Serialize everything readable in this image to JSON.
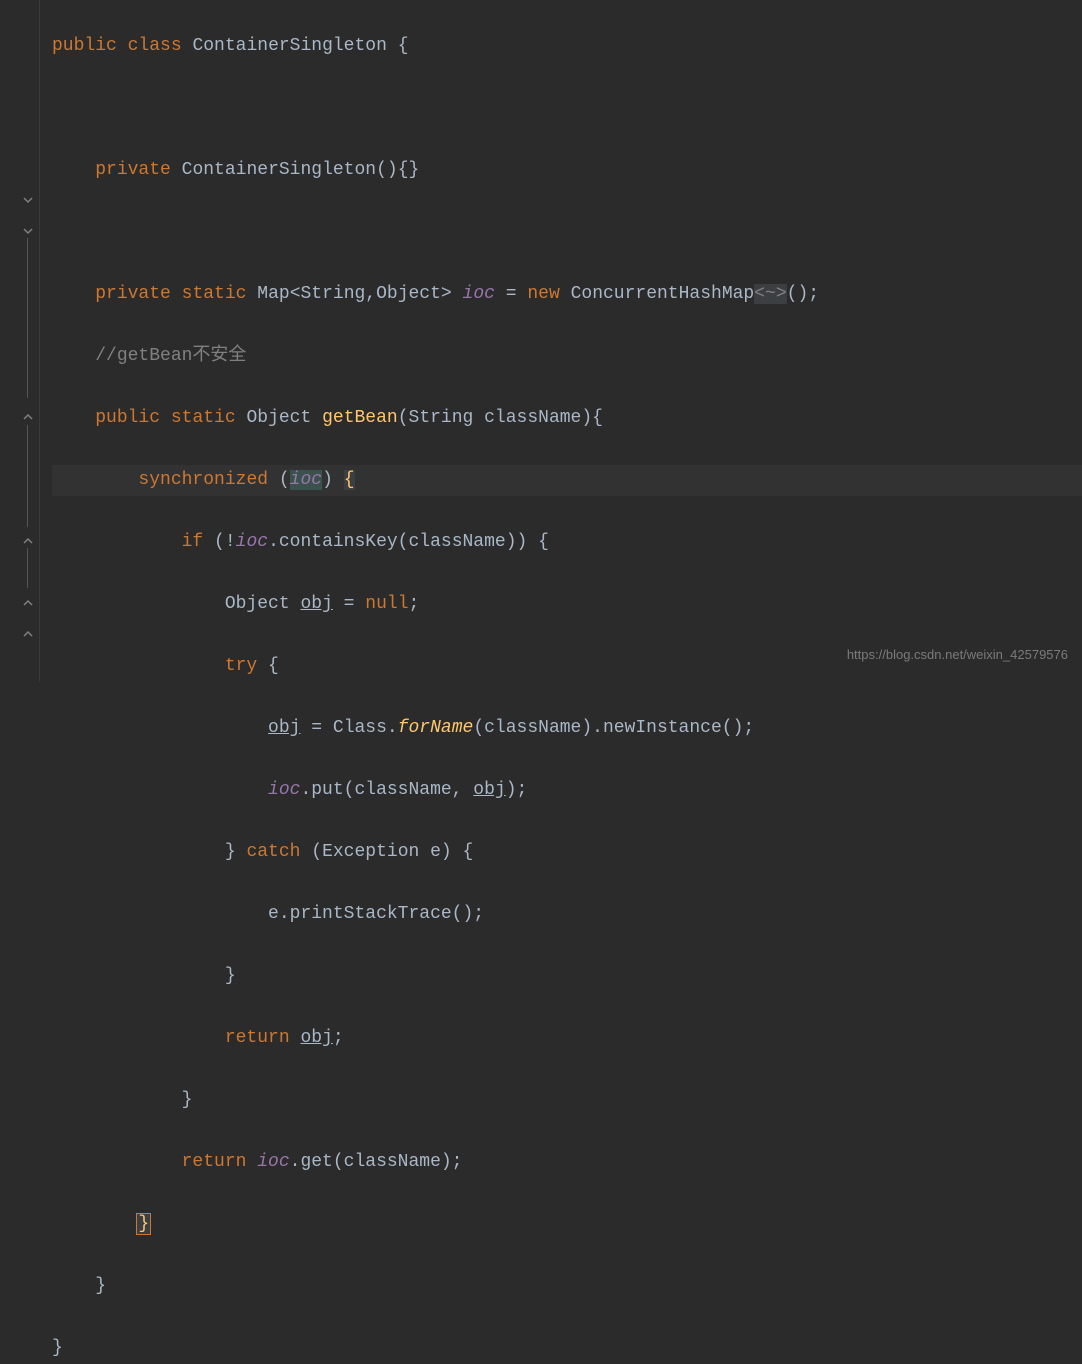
{
  "code": {
    "l1": {
      "kw1": "public",
      "kw2": "class",
      "cls": "ContainerSingleton",
      "open": "{"
    },
    "l3": {
      "kw1": "private",
      "ctor": "ContainerSingleton",
      "parens": "()",
      "braces": "{}"
    },
    "l5": {
      "kw1": "private",
      "kw2": "static",
      "type": "Map",
      "generic": "<String,Object>",
      "var": "ioc",
      "eq": "=",
      "kw3": "new",
      "cls": "ConcurrentHashMap",
      "fold": "<~>",
      "call": "();"
    },
    "l6": {
      "cmt": "//getBean不安全"
    },
    "l7": {
      "kw1": "public",
      "kw2": "static",
      "rtype": "Object",
      "fn": "getBean",
      "open": "(String className){"
    },
    "l8": {
      "kw": "synchronized",
      "open": "(",
      "var": "ioc",
      "close": ")",
      "brace": "{"
    },
    "l9": {
      "kw": "if",
      "open": "(!",
      "var": "ioc",
      "call": ".containsKey(className)) {"
    },
    "l10": {
      "type": "Object",
      "var": "obj",
      "eq": "=",
      "null": "null",
      "semi": ";"
    },
    "l11": {
      "kw": "try",
      "brace": "{"
    },
    "l12": {
      "var": "obj",
      "eq": "=",
      "cls": "Class.",
      "fn": "forName",
      "args": "(className).newInstance();"
    },
    "l13": {
      "var": "ioc",
      "call": ".put(className, ",
      "var2": "obj",
      "end": ");"
    },
    "l14": {
      "close": "}",
      "kw": "catch",
      "args": "(Exception e) {"
    },
    "l15": {
      "text": "e.printStackTrace();"
    },
    "l16": {
      "close": "}"
    },
    "l17": {
      "kw": "return",
      "var": "obj",
      "semi": ";"
    },
    "l18": {
      "close": "}"
    },
    "l19": {
      "kw": "return",
      "var": "ioc",
      "call": ".get(className);"
    },
    "l20": {
      "close": "}"
    },
    "l21": {
      "close": "}"
    },
    "l22": {
      "close": "}"
    }
  },
  "watermark": "https://blog.csdn.net/weixin_42579576"
}
